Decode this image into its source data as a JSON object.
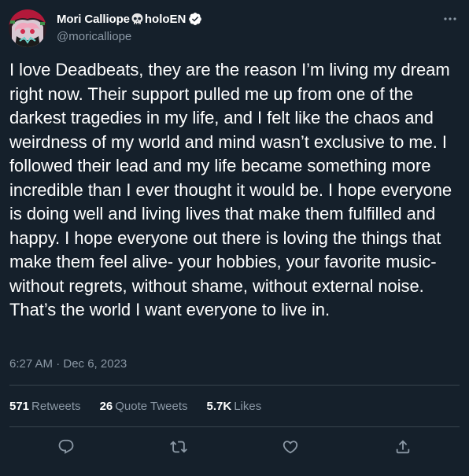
{
  "author": {
    "display_name": "Mori Calliope",
    "name_suffix": "holoEN",
    "handle": "@moricalliope",
    "verified": true
  },
  "tweet": {
    "text": "I love Deadbeats, they are the reason I’m living my dream right now. Their support pulled me up from one of the darkest tragedies in my life, and I felt like the chaos and weirdness of my world and mind wasn’t exclusive to me. I followed their lead and my life became something more incredible than I ever thought it would be. I hope everyone is doing well and living lives that make them fulfilled and happy. I hope everyone out there is loving the things that make them feel alive- your hobbies, your favorite music- without regrets, without shame, without external noise. That’s the world I want everyone to live in.",
    "timestamp": "6:27 AM · Dec 6, 2023"
  },
  "stats": {
    "retweets_count": "571",
    "retweets_label": "Retweets",
    "quotes_count": "26",
    "quotes_label": "Quote Tweets",
    "likes_count": "5.7K",
    "likes_label": "Likes"
  },
  "icons": {
    "more": "more-horizontal-icon",
    "skull": "skull-emoji-icon",
    "verified": "verified-badge-icon",
    "reply": "reply-icon",
    "retweet": "retweet-icon",
    "like": "heart-icon",
    "share": "share-icon"
  },
  "colors": {
    "background": "#15202b",
    "text": "#ffffff",
    "secondary_text": "#8b98a5",
    "divider": "#38444d"
  }
}
